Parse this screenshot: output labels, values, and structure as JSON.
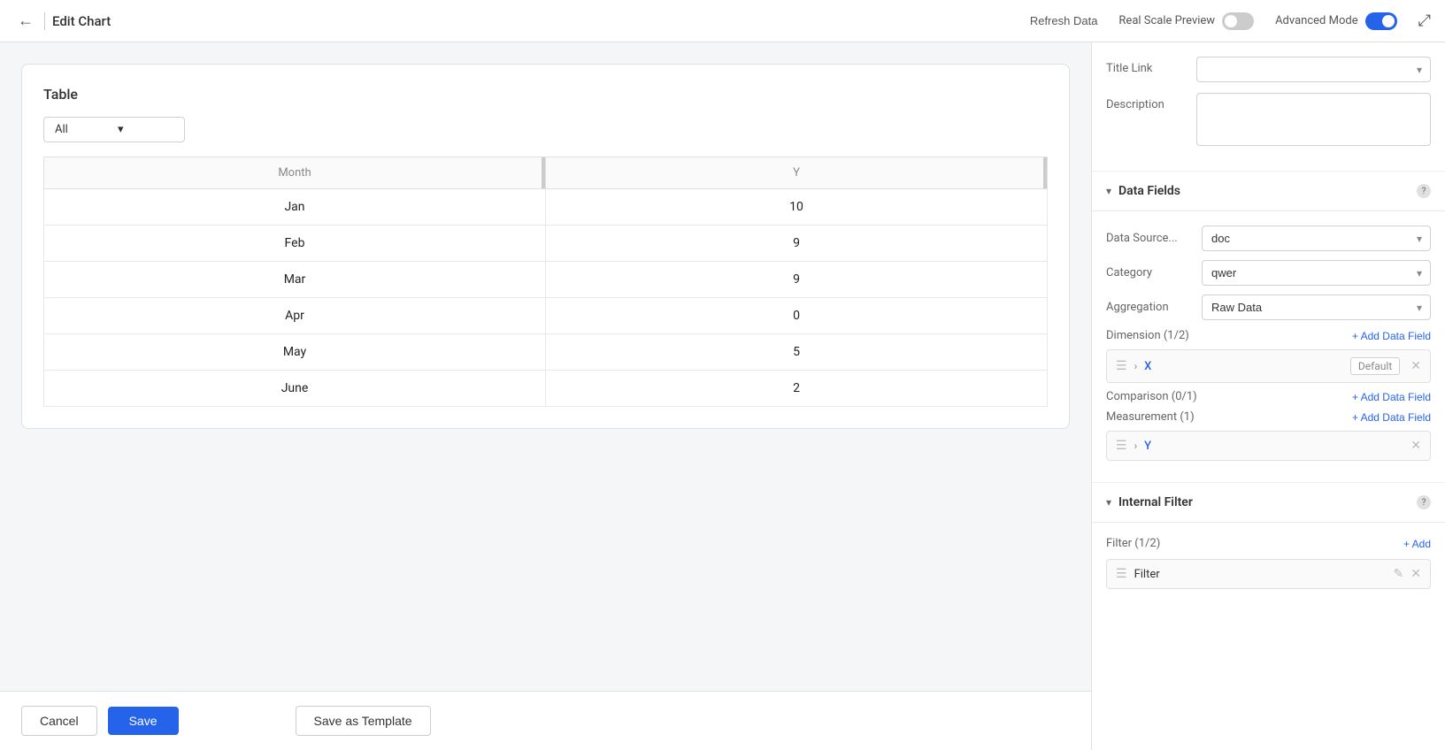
{
  "header": {
    "back_icon": "←",
    "title": "Edit Chart",
    "refresh_label": "Refresh Data",
    "real_scale_label": "Real Scale Preview",
    "advanced_mode_label": "Advanced Mode",
    "expand_icon": "⤢"
  },
  "top_fields": {
    "title_link_label": "Title Link",
    "description_label": "Description"
  },
  "data_fields": {
    "section_title": "Data Fields",
    "data_source_label": "Data Source...",
    "data_source_value": "doc",
    "category_label": "Category",
    "category_value": "qwer",
    "aggregation_label": "Aggregation",
    "aggregation_value": "Raw Data",
    "dimension_label": "Dimension (1/2)",
    "add_field_label": "+ Add Data Field",
    "dimension_field_name": "X",
    "dimension_field_tag": "Default",
    "comparison_label": "Comparison (0/1)",
    "add_field_label2": "+ Add Data Field",
    "measurement_label": "Measurement (1)",
    "add_field_label3": "+ Add Data Field",
    "measurement_field_name": "Y"
  },
  "internal_filter": {
    "section_title": "Internal Filter",
    "filter_label": "Filter (1/2)",
    "add_label": "+ Add",
    "filter_name": "Filter"
  },
  "chart": {
    "title": "Table",
    "filter_all": "All",
    "columns": [
      "Month",
      "Y"
    ],
    "rows": [
      {
        "month": "Jan",
        "y": "10"
      },
      {
        "month": "Feb",
        "y": "9"
      },
      {
        "month": "Mar",
        "y": "9"
      },
      {
        "month": "Apr",
        "y": "0"
      },
      {
        "month": "May",
        "y": "5"
      },
      {
        "month": "June",
        "y": "2"
      }
    ]
  },
  "footer": {
    "cancel_label": "Cancel",
    "save_label": "Save",
    "template_label": "Save as Template"
  }
}
